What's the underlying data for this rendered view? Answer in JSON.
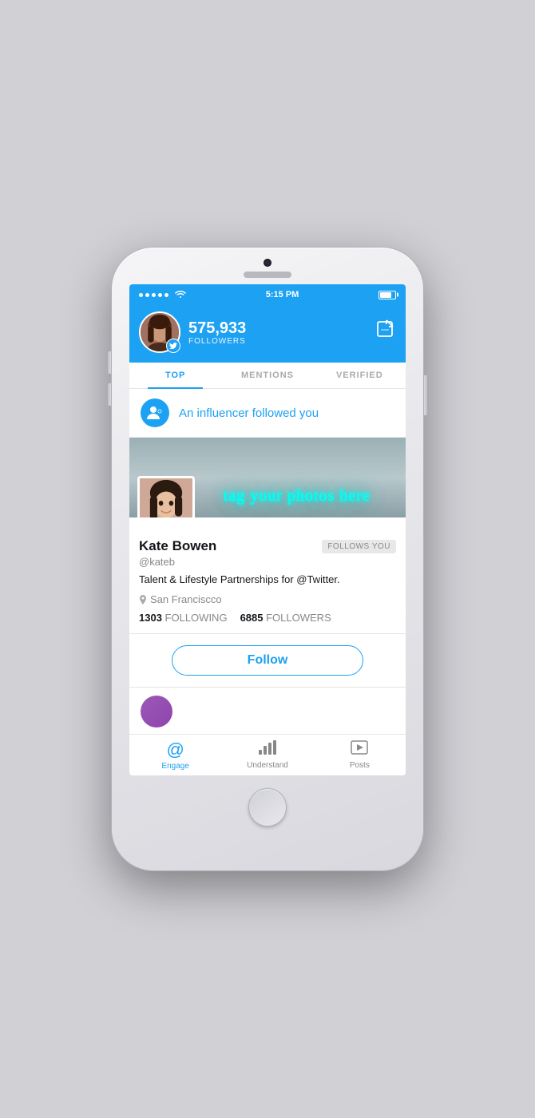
{
  "phone": {
    "status_bar": {
      "time": "5:15 PM",
      "signal_dots": 5,
      "wifi": true,
      "battery_percent": 80
    },
    "header": {
      "followers_count": "575,933",
      "followers_label": "FOLLOWERS",
      "compose_icon": "✏"
    },
    "tabs": [
      {
        "id": "top",
        "label": "TOP",
        "active": true
      },
      {
        "id": "mentions",
        "label": "MENTIONS",
        "active": false
      },
      {
        "id": "verified",
        "label": "VERIFIED",
        "active": false
      }
    ],
    "notification": {
      "text": "An influencer followed you"
    },
    "profile_card": {
      "name": "Kate Bowen",
      "handle": "@kateb",
      "bio": "Talent & Lifestyle Partnerships for @Twitter.",
      "location": "San Franciscco",
      "following_count": "1303",
      "following_label": "FOLLOWING",
      "followers_count": "6885",
      "followers_label": "FOLLOWERS",
      "follows_you_badge": "FOLLOWS YOU",
      "banner_neon_text": "tag your photos here"
    },
    "follow_button": {
      "label": "Follow"
    },
    "bottom_nav": [
      {
        "id": "engage",
        "icon": "@",
        "label": "Engage",
        "active": true
      },
      {
        "id": "understand",
        "icon": "bar",
        "label": "Understand",
        "active": false
      },
      {
        "id": "posts",
        "icon": "play",
        "label": "Posts",
        "active": false
      }
    ]
  }
}
